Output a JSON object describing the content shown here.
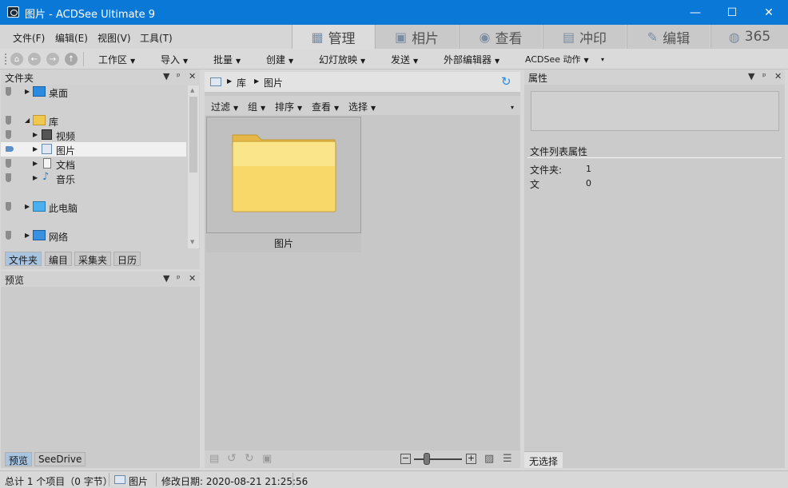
{
  "window": {
    "title": "图片 - ACDSee Ultimate 9",
    "controls": {
      "minimize": "—",
      "maximize": "☐",
      "close": "✕"
    }
  },
  "menu": [
    "文件(F)",
    "编辑(E)",
    "视图(V)",
    "工具(T)"
  ],
  "mode_tabs": [
    {
      "label": "管理",
      "icon": "grid-icon",
      "active": true
    },
    {
      "label": "相片",
      "icon": "photos-icon",
      "active": false
    },
    {
      "label": "查看",
      "icon": "eye-icon",
      "active": false
    },
    {
      "label": "冲印",
      "icon": "develop-icon",
      "active": false
    },
    {
      "label": "编辑",
      "icon": "edit-icon",
      "active": false
    },
    {
      "label": "365",
      "icon": "365-icon",
      "active": false
    }
  ],
  "toolbar": {
    "nav_icons": [
      "home-icon",
      "back-icon",
      "forward-icon",
      "up-icon"
    ],
    "items": [
      "工作区",
      "导入",
      "批量",
      "创建",
      "幻灯放映",
      "发送",
      "外部编辑器",
      "ACDSee 动作"
    ]
  },
  "folders_panel": {
    "title": "文件夹",
    "tree": [
      {
        "label": "桌面",
        "icon": "desktop-icon"
      },
      {
        "label": "库",
        "icon": "library-icon"
      },
      {
        "label": "视频",
        "icon": "video-icon"
      },
      {
        "label": "图片",
        "icon": "pictures-icon"
      },
      {
        "label": "文档",
        "icon": "documents-icon"
      },
      {
        "label": "音乐",
        "icon": "music-icon"
      },
      {
        "label": "此电脑",
        "icon": "computer-icon"
      },
      {
        "label": "网络",
        "icon": "network-icon"
      }
    ],
    "tabs": [
      "文件夹",
      "编目",
      "采集夹",
      "日历"
    ]
  },
  "preview_panel": {
    "title": "预览",
    "tabs": [
      "预览",
      "SeeDrive"
    ]
  },
  "center": {
    "breadcrumb": [
      "库",
      "图片"
    ],
    "filter_items": [
      "过滤",
      "组",
      "排序",
      "查看",
      "选择"
    ],
    "tile_label": "图片"
  },
  "properties": {
    "title": "属性",
    "section": "文件列表属性",
    "rows": [
      {
        "key": "文件夹:",
        "value": "1"
      },
      {
        "key": "文",
        "value": "0"
      }
    ],
    "tab": "无选择"
  },
  "status": {
    "total": "总计 1 个项目（0 字节）",
    "location": "图片",
    "modified": "修改日期: 2020-08-21 21:25:56"
  },
  "colors": {
    "titlebar": "#0a78d7",
    "accent": "#2a8be0",
    "folder": "#f5d060"
  }
}
